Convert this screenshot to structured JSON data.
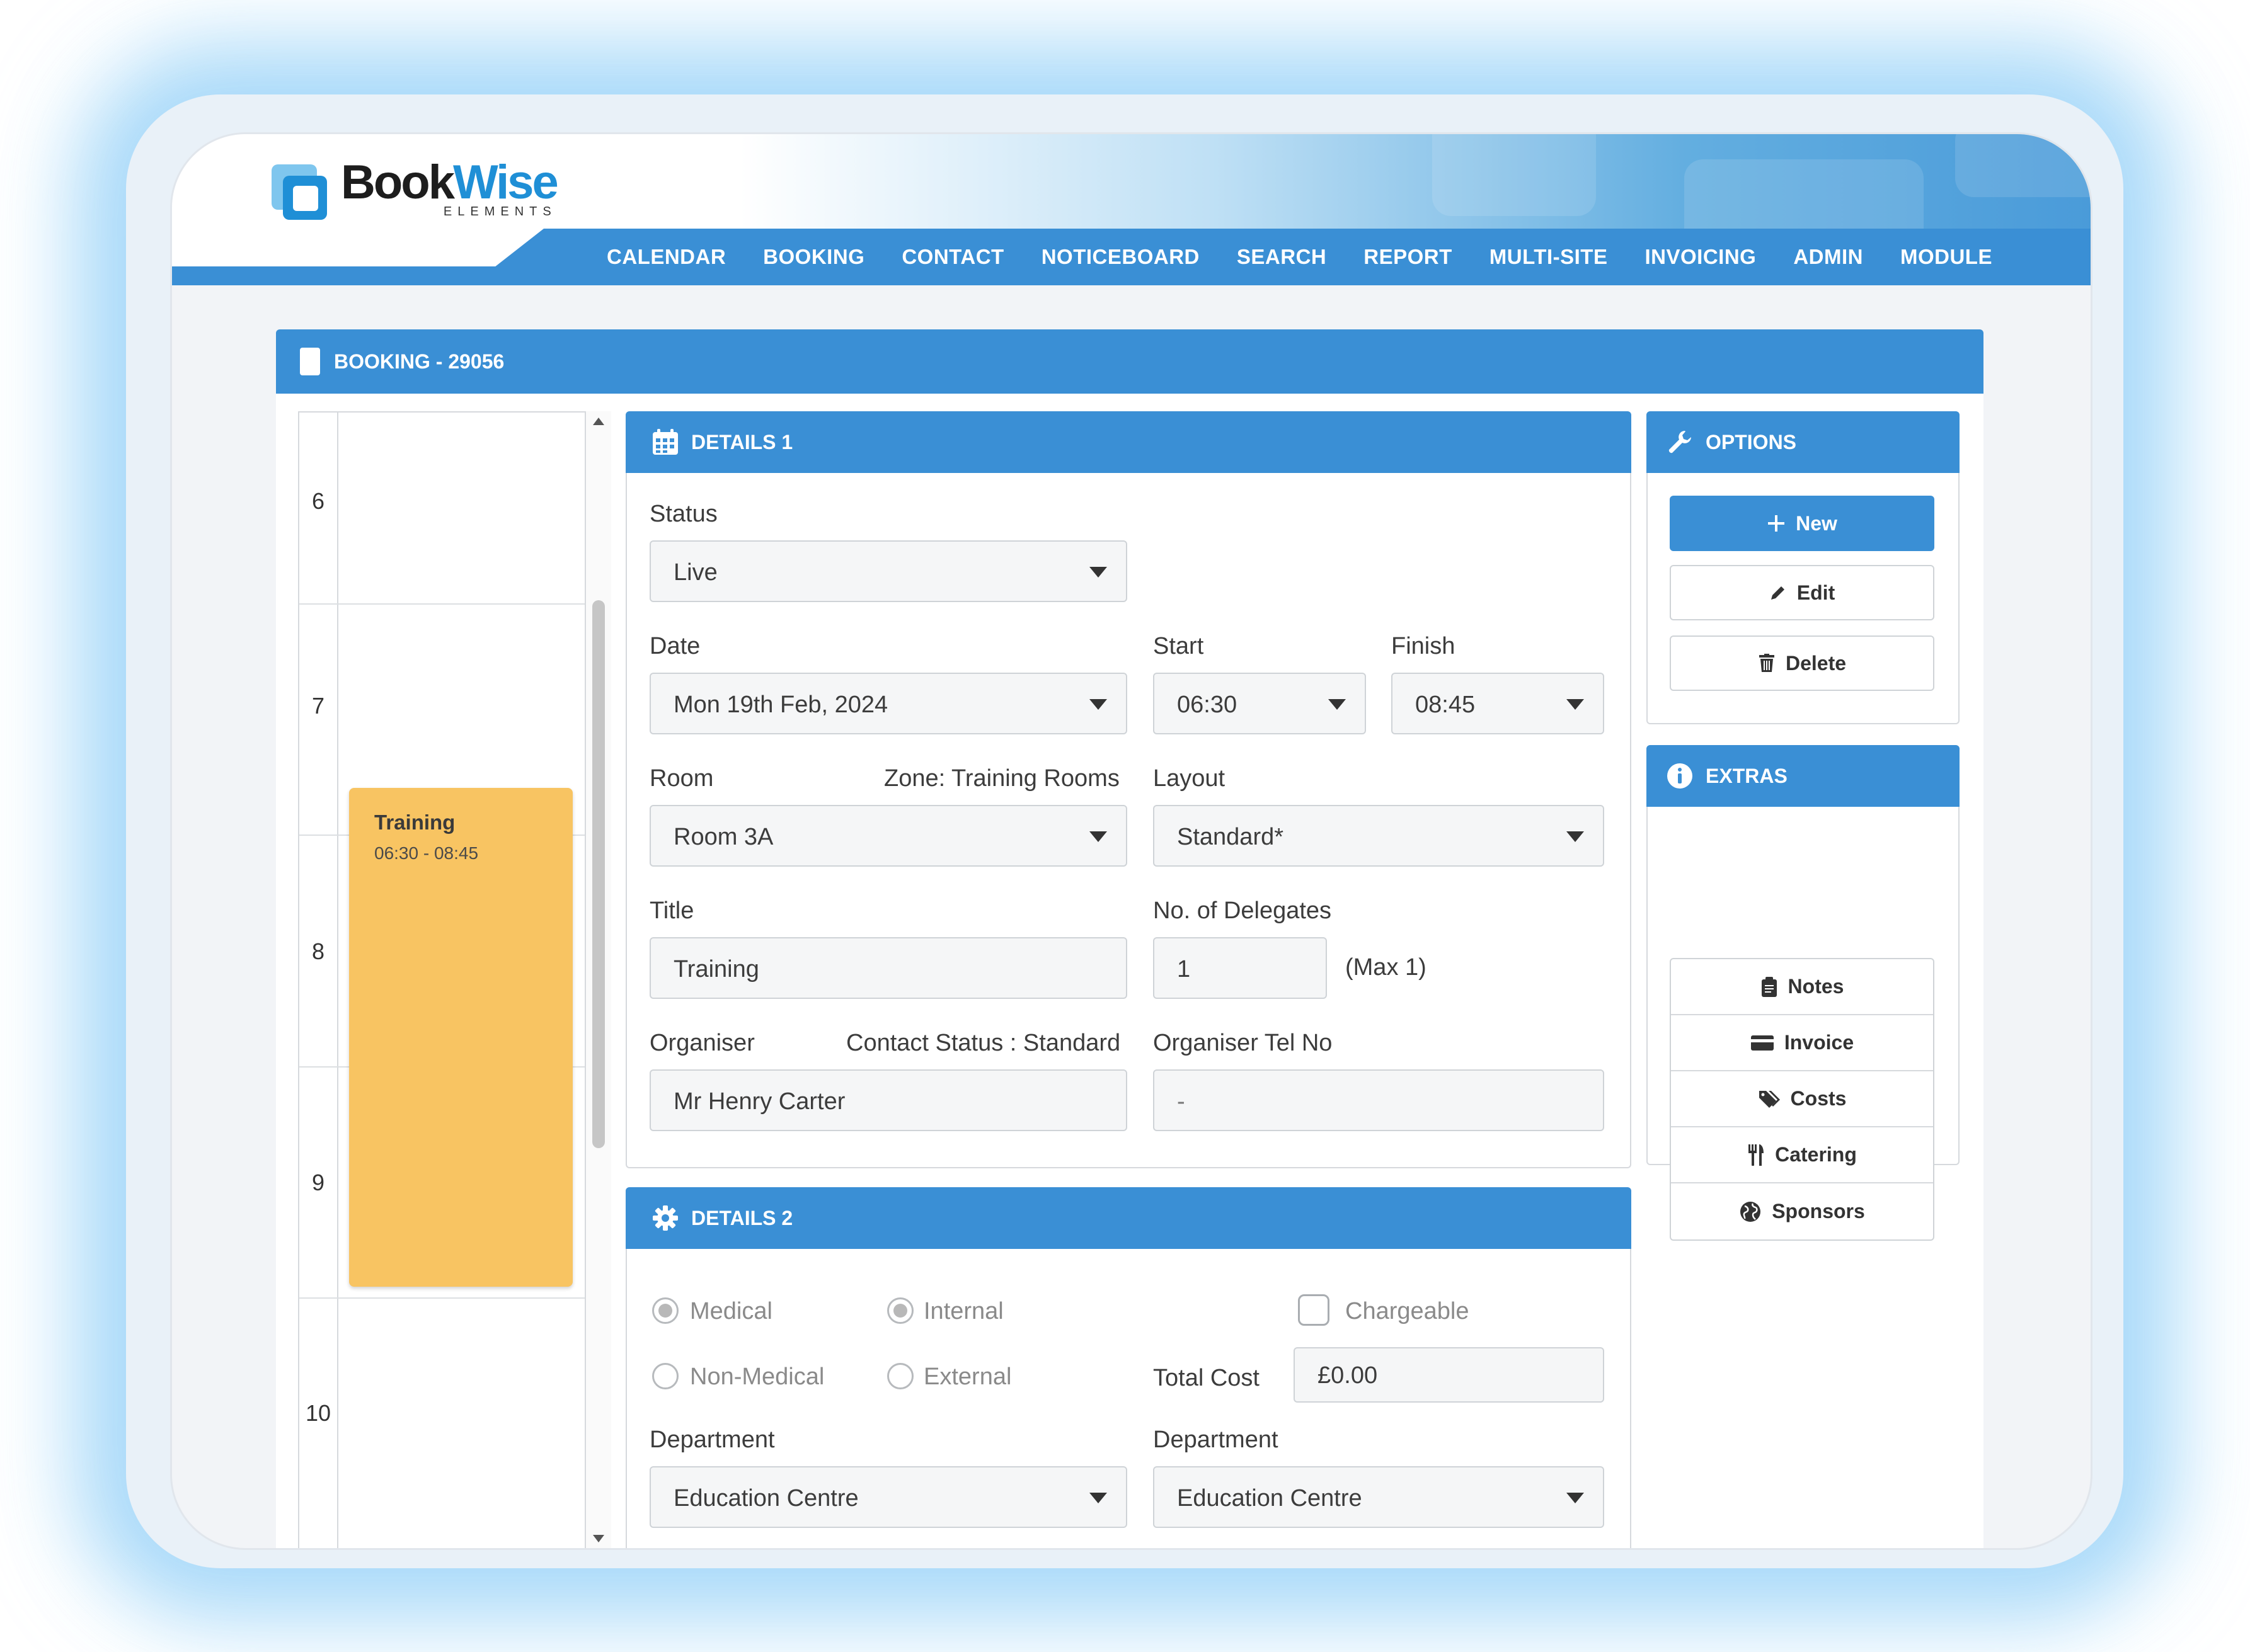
{
  "app": {
    "logo_name_part1": "Book",
    "logo_name_part2": "Wise",
    "logo_sub": "ELEMENTS"
  },
  "nav": [
    "CALENDAR",
    "BOOKING",
    "CONTACT",
    "NOTICEBOARD",
    "SEARCH",
    "REPORT",
    "MULTI-SITE",
    "INVOICING",
    "ADMIN",
    "MODULE"
  ],
  "booking": {
    "title": "BOOKING - 29056"
  },
  "day_view": {
    "hours": [
      "6",
      "7",
      "8",
      "9",
      "10"
    ],
    "event": {
      "title": "Training",
      "time": "06:30 - 08:45"
    }
  },
  "details1": {
    "header": "DETAILS 1",
    "status_label": "Status",
    "status_value": "Live",
    "date_label": "Date",
    "date_value": "Mon 19th Feb, 2024",
    "start_label": "Start",
    "start_value": "06:30",
    "finish_label": "Finish",
    "finish_value": "08:45",
    "room_label": "Room",
    "zone_text": "Zone: Training Rooms",
    "room_value": "Room 3A",
    "layout_label": "Layout",
    "layout_value": "Standard*",
    "title_label": "Title",
    "title_value": "Training",
    "delegates_label": "No. of Delegates",
    "delegates_value": "1",
    "delegates_max": "(Max 1)",
    "organiser_label": "Organiser",
    "contact_status": "Contact Status : Standard",
    "organiser_value": "Mr Henry Carter",
    "organiser_tel_label": "Organiser Tel No",
    "organiser_tel_value": "-"
  },
  "details2": {
    "header": "DETAILS 2",
    "radio_medical": "Medical",
    "radio_internal": "Internal",
    "radio_non_medical": "Non-Medical",
    "radio_external": "External",
    "chargeable_label": "Chargeable",
    "total_cost_label": "Total Cost",
    "total_cost_value": "£0.00",
    "department_label_1": "Department",
    "department_value_1": "Education Centre",
    "department_label_2": "Department",
    "department_value_2": "Education Centre"
  },
  "options": {
    "header": "OPTIONS",
    "new": "New",
    "edit": "Edit",
    "delete": "Delete"
  },
  "extras": {
    "header": "EXTRAS",
    "items": [
      "Notes",
      "Invoice",
      "Costs",
      "Catering",
      "Sponsors"
    ]
  },
  "colors": {
    "primary": "#3a8fd5",
    "event": "#f8c462",
    "field_bg": "#f5f6f7"
  }
}
